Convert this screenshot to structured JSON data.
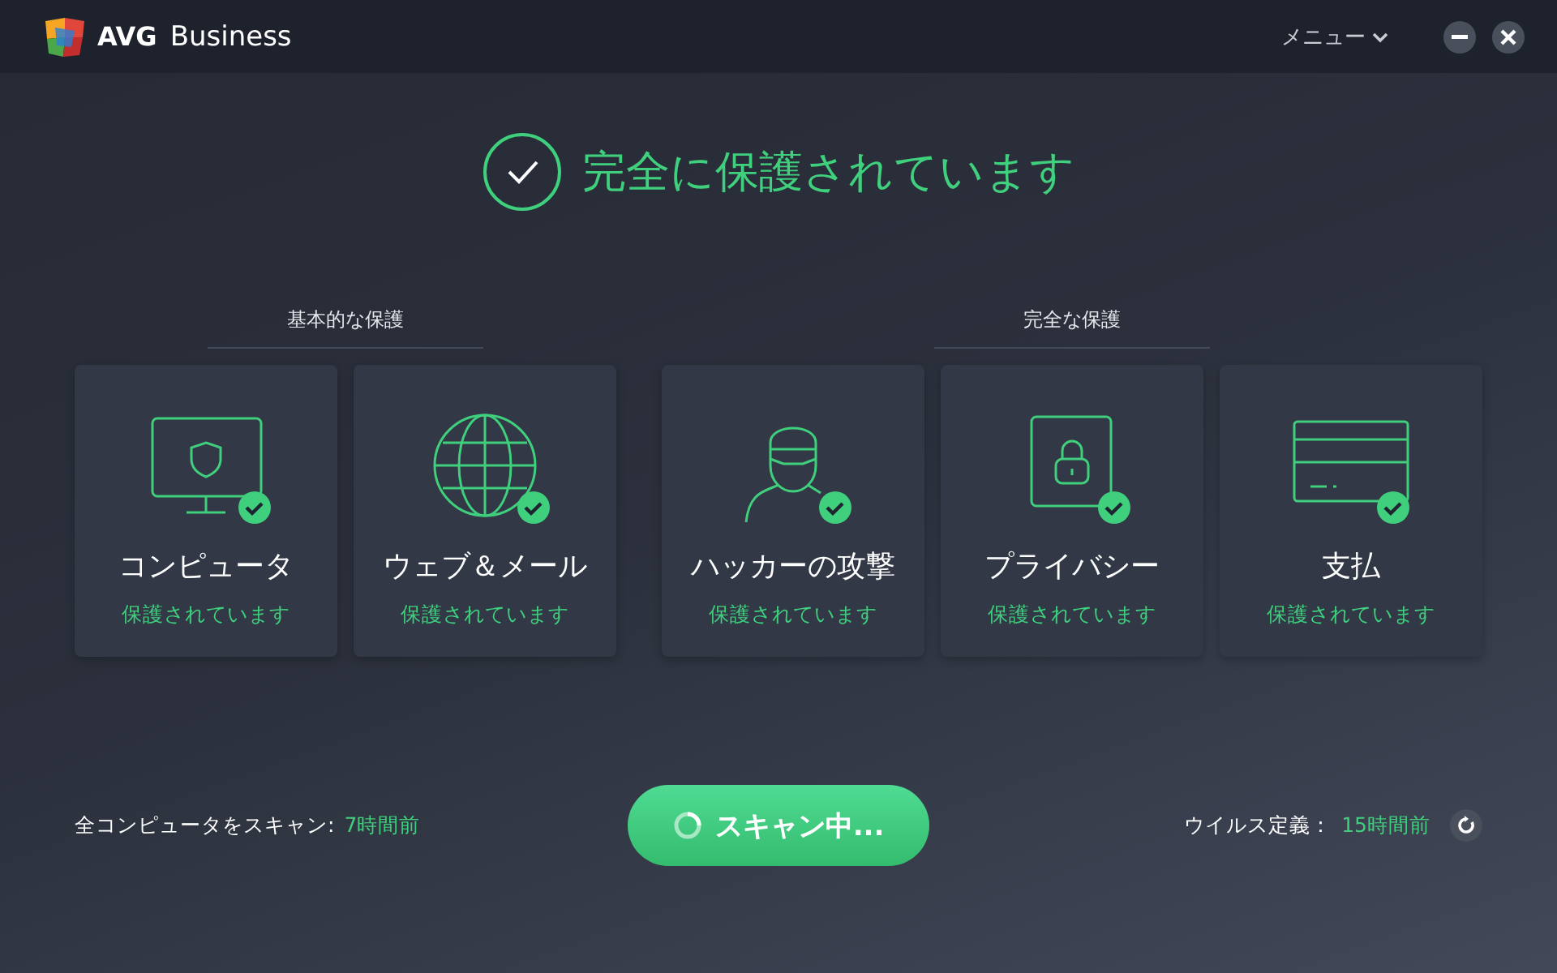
{
  "app": {
    "brand": "AVG",
    "product": "Business",
    "menu": "メニュー"
  },
  "status": {
    "title": "完全に保護されています"
  },
  "groups": [
    {
      "title": "基本的な保護",
      "cards": [
        {
          "kind": "monitor",
          "title": "コンピュータ",
          "status": "保護されています"
        },
        {
          "kind": "globe",
          "title": "ウェブ＆メール",
          "status": "保護されています"
        }
      ]
    },
    {
      "title": "完全な保護",
      "cards": [
        {
          "kind": "hacker",
          "title": "ハッカーの攻撃",
          "status": "保護されています"
        },
        {
          "kind": "lock",
          "title": "プライバシー",
          "status": "保護されています"
        },
        {
          "kind": "card",
          "title": "支払",
          "status": "保護されています"
        }
      ]
    }
  ],
  "footer": {
    "scan_label": "全コンピュータをスキャン:",
    "scan_time": "7時間前",
    "scan_button": "スキャン中...",
    "defs_label": "ウイルス定義：",
    "defs_time": "15時間前"
  }
}
